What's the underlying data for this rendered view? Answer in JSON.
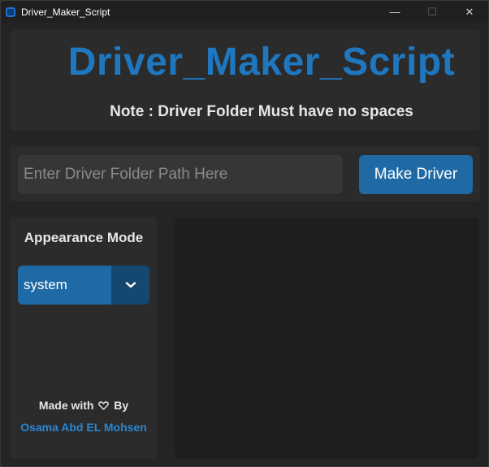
{
  "window": {
    "title": "Driver_Maker_Script",
    "controls": {
      "minimize": "—",
      "maximize": "☐",
      "close": "✕"
    }
  },
  "header": {
    "title": "Driver_Maker_Script",
    "note": "Note : Driver Folder Must have no spaces"
  },
  "input": {
    "placeholder": "Enter Driver Folder Path Here",
    "value": ""
  },
  "actions": {
    "make_driver_label": "Make Driver"
  },
  "sidebar": {
    "appearance_label": "Appearance Mode",
    "appearance_selected": "system",
    "made_with_prefix": "Made with",
    "made_with_suffix": "By",
    "author": "Osama Abd EL Mohsen"
  },
  "colors": {
    "accent": "#1f6aa5",
    "title_blue": "#1f77c0",
    "author_blue": "#2a86d1",
    "background": "#242424"
  },
  "icons": {
    "app": "app-icon",
    "heart": "heart-icon",
    "dropdown": "chevron-down-icon"
  }
}
